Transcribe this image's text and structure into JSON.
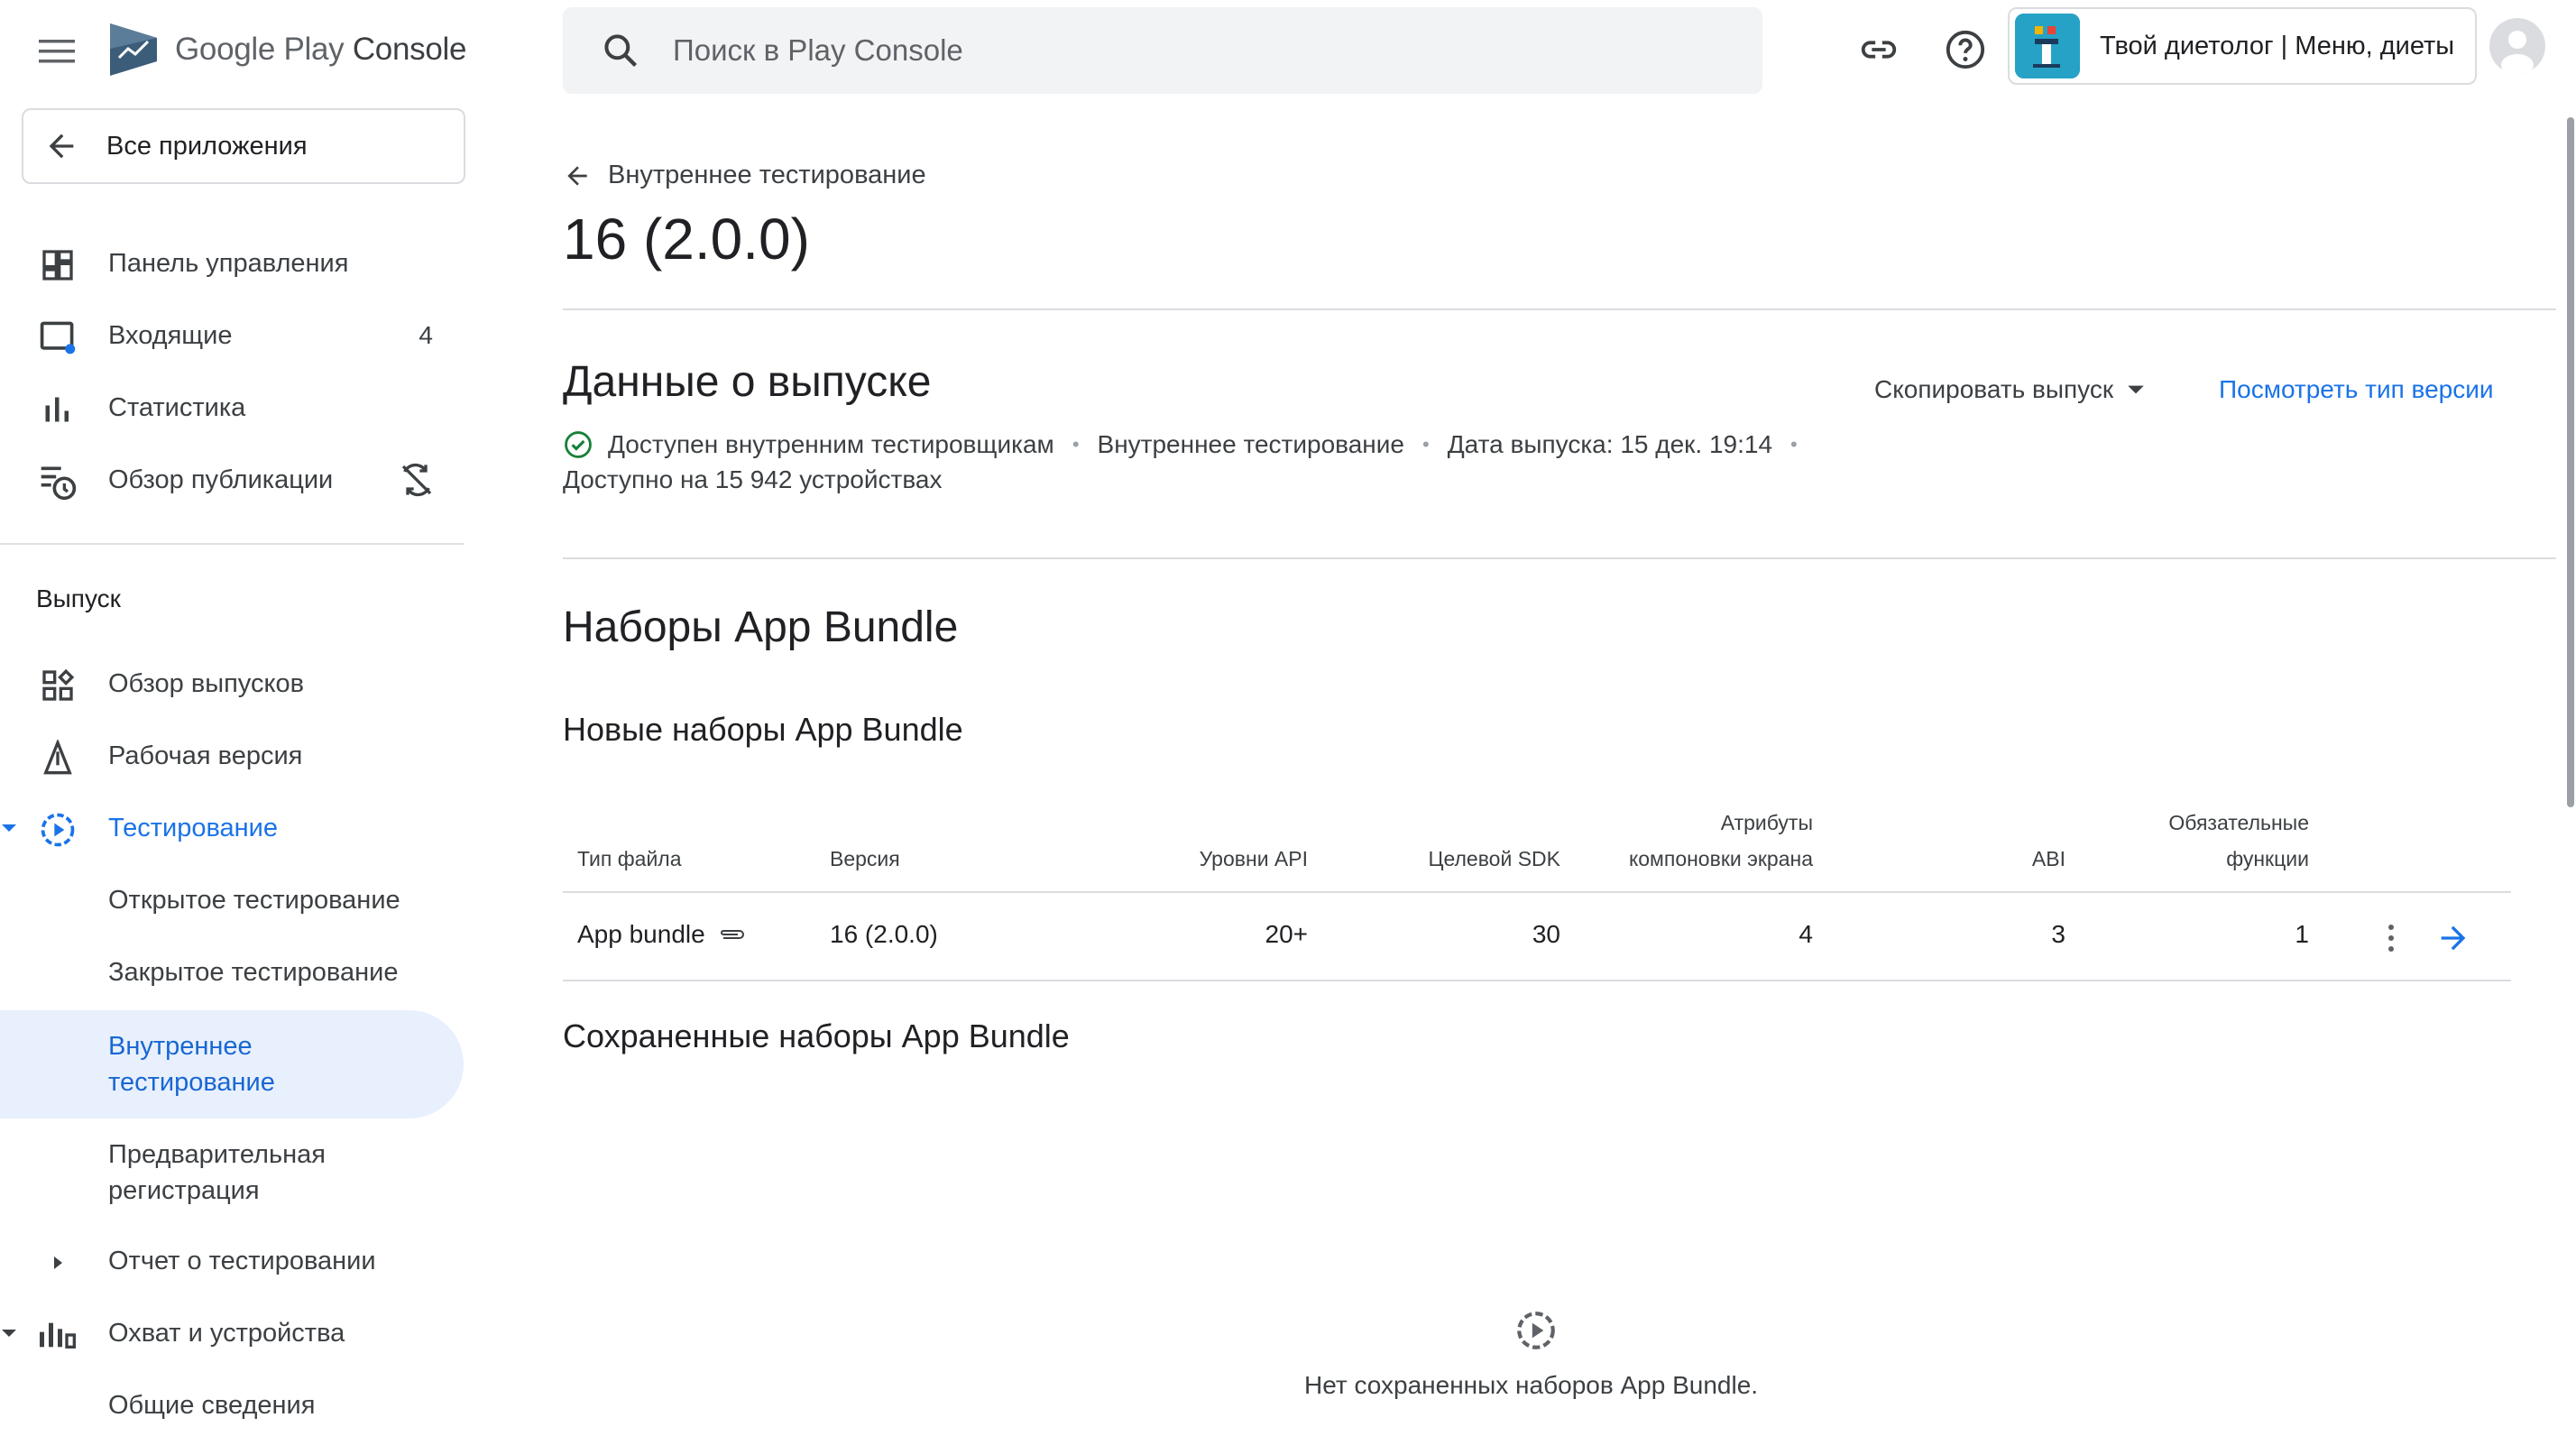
{
  "brand": {
    "name_part1": "Google Play",
    "name_part2": "Console"
  },
  "sidebar": {
    "all_apps": "Все приложения",
    "top_items": [
      {
        "label": "Панель управления",
        "icon": "dashboard-icon"
      },
      {
        "label": "Входящие",
        "icon": "inbox-icon",
        "count": "4"
      },
      {
        "label": "Статистика",
        "icon": "bar-chart-icon"
      },
      {
        "label": "Обзор публикации",
        "icon": "publishing-overview-icon"
      }
    ],
    "section_release": "Выпуск",
    "release_items": [
      {
        "label": "Обзор выпусков",
        "icon": "releases-overview-icon"
      },
      {
        "label": "Рабочая версия",
        "icon": "production-icon"
      },
      {
        "label": "Тестирование",
        "icon": "testing-icon"
      }
    ],
    "testing_sub": [
      {
        "label": "Открытое тестирование"
      },
      {
        "label": "Закрытое тестирование"
      },
      {
        "label_line1": "Внутреннее",
        "label_line2": "тестирование"
      },
      {
        "label_line1": "Предварительная",
        "label_line2": "регистрация"
      }
    ],
    "test_report": "Отчет о тестировании",
    "reach": "Охват и устройства",
    "overview": "Общие сведения"
  },
  "search": {
    "placeholder": "Поиск в Play Console"
  },
  "app": {
    "name": "Твой диетолог | Меню, диеты"
  },
  "main": {
    "back_label": "Внутреннее тестирование",
    "title": "16 (2.0.0)",
    "release_details_title": "Данные о выпуске",
    "copy_release": "Скопировать выпуск",
    "view_version_type": "Посмотреть тип версии",
    "status": "Доступен внутренним тестировщикам",
    "track": "Внутреннее тестирование",
    "release_date": "Дата выпуска: 15 дек. 19:14",
    "devices": "Доступно на 15 942 устройствах",
    "bundles_title": "Наборы App Bundle",
    "new_bundles_title": "Новые наборы App Bundle",
    "table": {
      "headers": {
        "file_type": "Тип файла",
        "version": "Версия",
        "api_levels": "Уровни API",
        "target_sdk": "Целевой SDK",
        "screen_layout_1": "Атрибуты",
        "screen_layout_2": "компоновки экрана",
        "abi": "ABI",
        "required_features_1": "Обязательные",
        "required_features_2": "функции"
      },
      "row": {
        "file_type": "App bundle",
        "version": "16 (2.0.0)",
        "api_levels": "20+",
        "target_sdk": "30",
        "screen_layout": "4",
        "abi": "3",
        "required_features": "1"
      }
    },
    "saved_bundles_title": "Сохраненные наборы App Bundle",
    "empty_saved": "Нет сохраненных наборов App Bundle."
  },
  "colors": {
    "accent": "#1a73e8",
    "selected_bg": "#e8f0fe",
    "success": "#188038"
  }
}
